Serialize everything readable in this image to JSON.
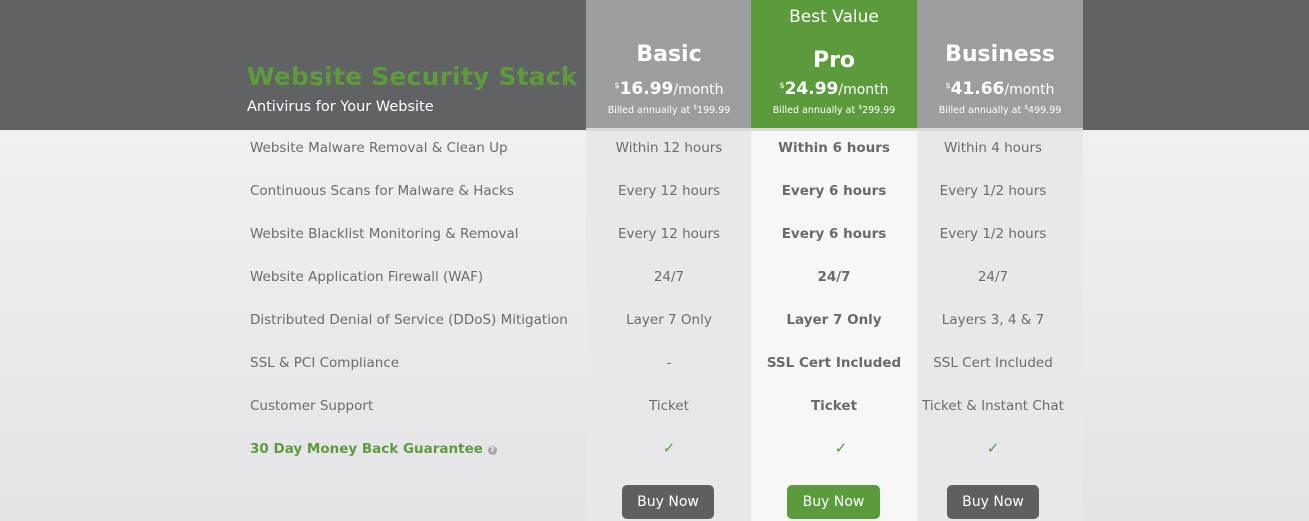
{
  "brand": {
    "title": "Website Security Stack",
    "subtitle": "Antivirus for Your Website"
  },
  "plans": [
    {
      "name": "Basic",
      "currency": "$",
      "price": "16.99",
      "period": "/month",
      "billed_prefix": "Billed annually at ",
      "billed_amount": "199.99",
      "buy_label": "Buy Now"
    },
    {
      "badge": "Best Value",
      "name": "Pro",
      "currency": "$",
      "price": "24.99",
      "period": "/month",
      "billed_prefix": "Billed annually at ",
      "billed_amount": "299.99",
      "buy_label": "Buy Now"
    },
    {
      "name": "Business",
      "currency": "$",
      "price": "41.66",
      "period": "/month",
      "billed_prefix": "Billed annually at ",
      "billed_amount": "499.99",
      "buy_label": "Buy Now"
    }
  ],
  "features": [
    {
      "label": "Website Malware Removal & Clean Up",
      "values": [
        "Within 12 hours",
        "Within 6 hours",
        "Within 4 hours"
      ]
    },
    {
      "label": "Continuous Scans for Malware & Hacks",
      "values": [
        "Every 12 hours",
        "Every 6 hours",
        "Every 1/2 hours"
      ]
    },
    {
      "label": "Website Blacklist Monitoring & Removal",
      "values": [
        "Every 12 hours",
        "Every 6 hours",
        "Every 1/2 hours"
      ]
    },
    {
      "label": "Website Application Firewall (WAF)",
      "values": [
        "24/7",
        "24/7",
        "24/7"
      ]
    },
    {
      "label": "Distributed Denial of Service (DDoS) Mitigation",
      "values": [
        "Layer 7 Only",
        "Layer 7 Only",
        "Layers 3, 4 & 7"
      ]
    },
    {
      "label": "SSL & PCI Compliance",
      "values": [
        "-",
        "SSL Cert Included",
        "SSL Cert Included"
      ]
    },
    {
      "label": "Customer Support",
      "values": [
        "Ticket",
        "Ticket",
        "Ticket & Instant Chat"
      ]
    }
  ],
  "guarantee": {
    "label": "30 Day Money Back Guarantee",
    "help_glyph": "?",
    "check_glyph": "✓",
    "help_icon": "question-circle-icon",
    "check_icon": "checkmark-icon"
  },
  "colors": {
    "brand_green": "#5d9b3c",
    "header_dark": "#616264",
    "header_gray": "#9c9d9f",
    "button_dark": "#5e5f61"
  }
}
